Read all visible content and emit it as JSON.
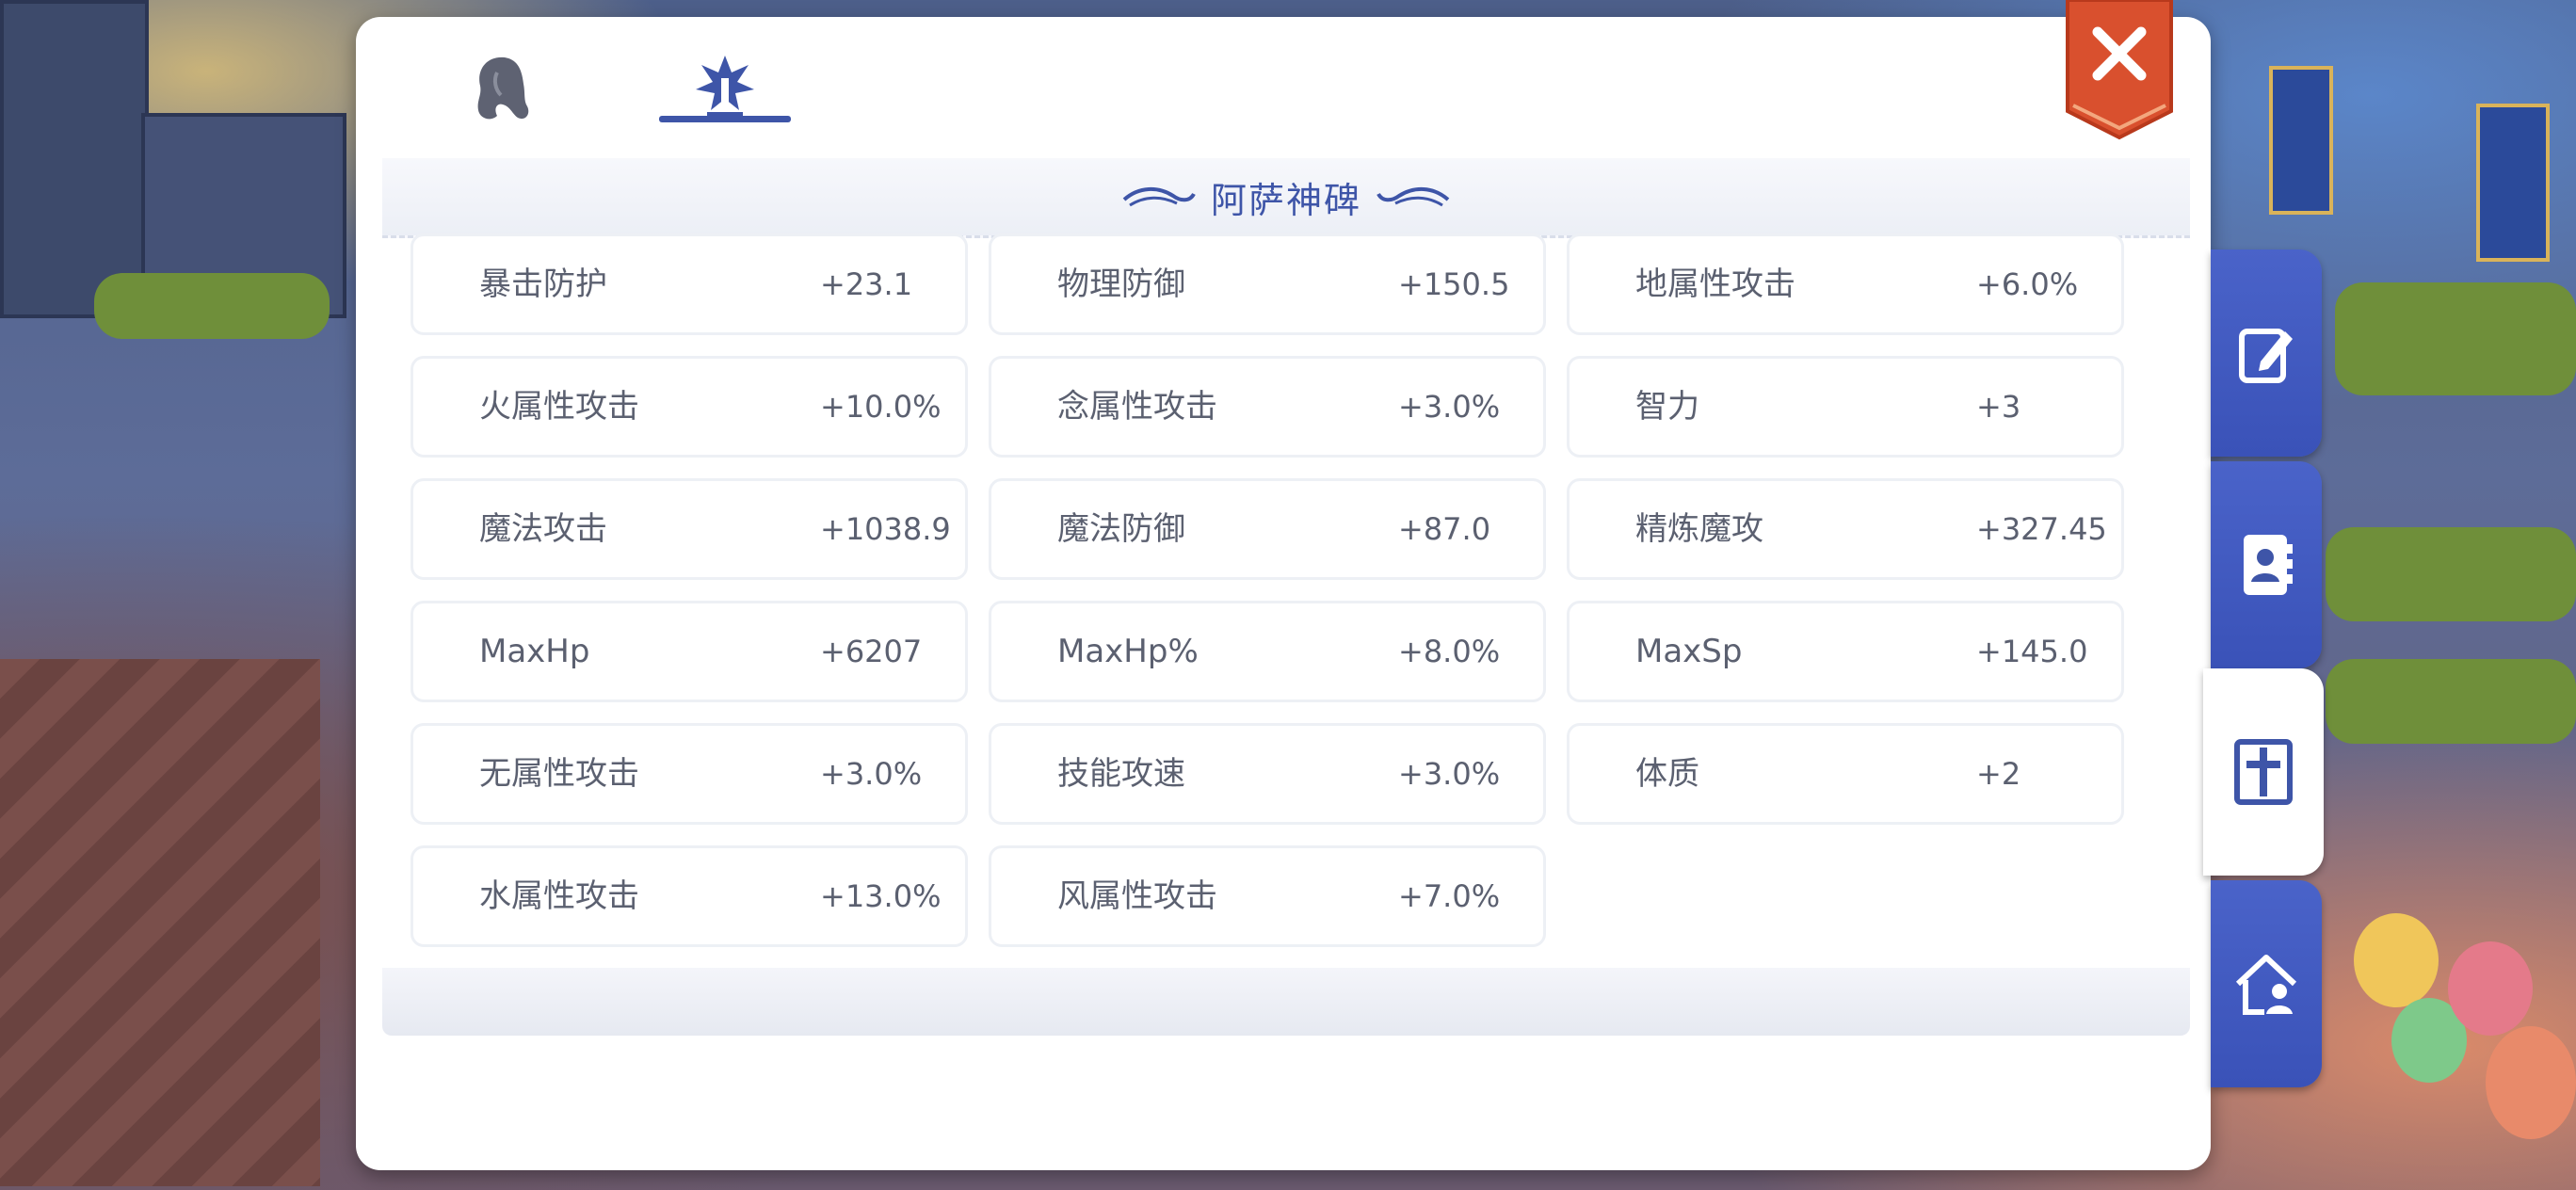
{
  "panel": {
    "title": "阿萨神碑",
    "tabs": [
      {
        "icon": "hair-icon",
        "active": false
      },
      {
        "icon": "emblem-icon",
        "active": true
      }
    ],
    "stats": [
      {
        "label": "暴击防护",
        "value": "+23.1"
      },
      {
        "label": "物理防御",
        "value": "+150.5"
      },
      {
        "label": "地属性攻击",
        "value": "+6.0%"
      },
      {
        "label": "火属性攻击",
        "value": "+10.0%"
      },
      {
        "label": "念属性攻击",
        "value": "+3.0%"
      },
      {
        "label": "智力",
        "value": "+3"
      },
      {
        "label": "魔法攻击",
        "value": "+1038.9"
      },
      {
        "label": "魔法防御",
        "value": "+87.0"
      },
      {
        "label": "精炼魔攻",
        "value": "+327.45"
      },
      {
        "label": "MaxHp",
        "value": "+6207"
      },
      {
        "label": "MaxHp%",
        "value": "+8.0%"
      },
      {
        "label": "MaxSp",
        "value": "+145.0"
      },
      {
        "label": "无属性攻击",
        "value": "+3.0%"
      },
      {
        "label": "技能攻速",
        "value": "+3.0%"
      },
      {
        "label": "体质",
        "value": "+2"
      },
      {
        "label": "水属性攻击",
        "value": "+13.0%"
      },
      {
        "label": "风属性攻击",
        "value": "+7.0%"
      }
    ]
  },
  "side_tabs": [
    {
      "icon": "edit-icon",
      "active": false
    },
    {
      "icon": "contacts-icon",
      "active": false
    },
    {
      "icon": "cross-emblem-icon",
      "active": true
    },
    {
      "icon": "guild-house-icon",
      "active": false
    }
  ],
  "colors": {
    "accent": "#3e55a8",
    "close_button": "#d9502e",
    "side_tab": "#4a63c9",
    "text": "#5b6070"
  }
}
